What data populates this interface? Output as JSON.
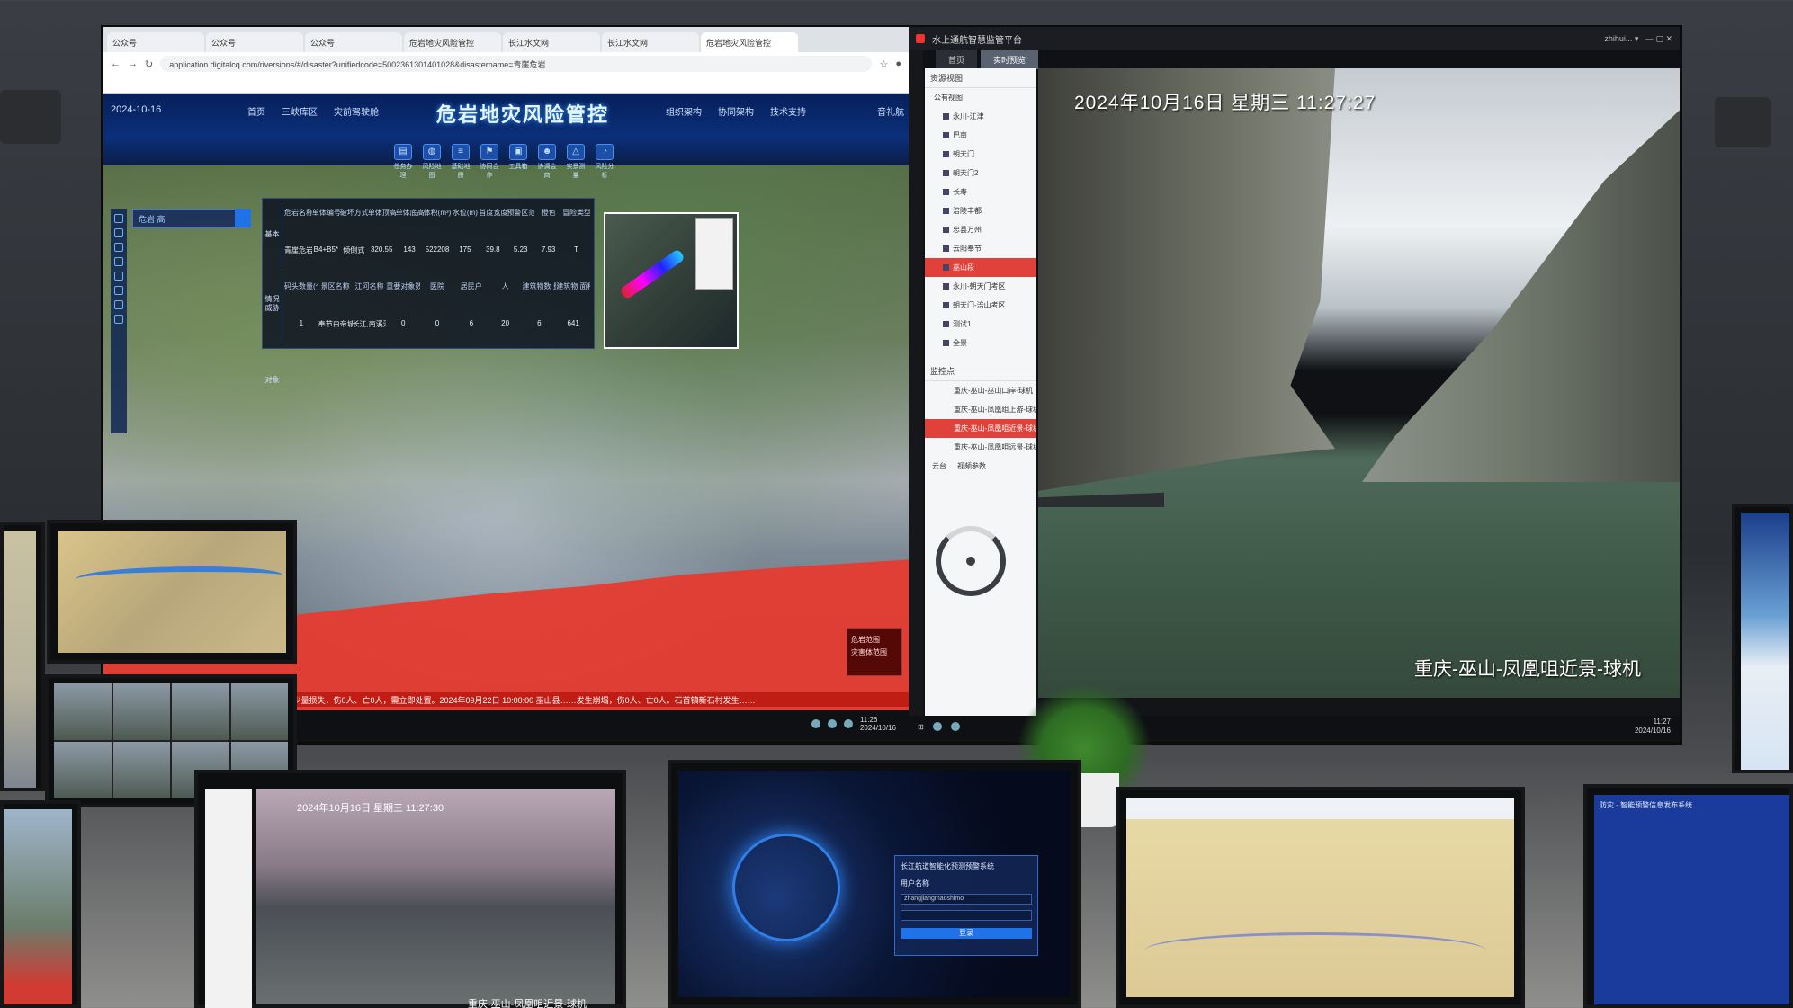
{
  "browser": {
    "tabs": [
      "公众号",
      "公众号",
      "公众号",
      "危岩地灾风险管控",
      "长江水文网",
      "长江水文网",
      "危岩地灾风险管控"
    ],
    "url": "application.digitalcq.com/riversions/#/disaster?unifiedcode=5002361301401028&disastername=青崖危岩"
  },
  "app": {
    "date": "2024-10-16",
    "nav_left": [
      "首页",
      "三峡库区",
      "灾前驾驶舱"
    ],
    "title": "危岩地灾风险管控",
    "nav_right": [
      "组织架构",
      "协同架构",
      "技术支持"
    ],
    "user": "音礼航",
    "tools": [
      "任务办理",
      "风险地图",
      "基础地质",
      "协同合作",
      "工具箱",
      "协调会商",
      "实景测量",
      "风险分析"
    ],
    "search_placeholder": "危岩   高",
    "info_table": {
      "section1": "基本情况",
      "headers1": [
        "危岩名称",
        "单体编号",
        "破坏方式",
        "单体顶高(m)",
        "单体底高(m)",
        "体积(m³)",
        "水位(m)",
        "首度宽度(m)",
        "预警区范围(km) 红色",
        "橙色",
        "冒险类型"
      ],
      "row1": [
        "青崖危岩",
        "B4+B5*",
        "倾倒式",
        "320.55",
        "143",
        "522208",
        "175",
        "39.8",
        "5.23",
        "7.93",
        "T"
      ],
      "section2": "威胁对象",
      "headers2": [
        "码头数量(个)",
        "景区名称",
        "江河名称",
        "重要对象数量 学校",
        "医院",
        "居民户",
        "人",
        "建筑物数 量(个)",
        "建筑物 面积(m²)"
      ],
      "row2": [
        "1",
        "奉节白帝城-瞿塘峡景区",
        "长江,南溪河,草堂河",
        "0",
        "0",
        "6",
        "20",
        "6",
        "641"
      ]
    },
    "legend": [
      "危岩范围",
      "灾害体范围"
    ],
    "ticker": "00 重庆市沙坪坝区歌乐山街道歌乐村发生崩塌，造成少量损失，伤0人、亡0人，需立即处置。2024年09月22日 10:00:00 巫山县……发生崩塌，伤0人、亡0人。石首镇新石村发生……",
    "taskbar_time": "11:26",
    "taskbar_date": "2024/10/16"
  },
  "monitor": {
    "window_title": "水上通航智慧监管平台",
    "user": "zhihui...",
    "tabs": [
      "首页",
      "实时预览"
    ],
    "tree_header": "资源视图",
    "root": "公有视图",
    "tree_items": [
      "永川-江津",
      "巴南",
      "朝天门",
      "朝天门2",
      "长寿",
      "涪陵丰都",
      "忠县万州",
      "云阳奉节",
      "巫山段",
      "永川-朝天门考区",
      "朝天门-涪山考区",
      "测试1",
      "全景"
    ],
    "selected_item": "巫山段",
    "monitor_points_header": "监控点",
    "points": [
      "重庆-巫山-巫山口岸-球机",
      "重庆-巫山-凤凰组上游-球机",
      "重庆-巫山-凤凰咀近景-球机",
      "重庆-巫山-凤凰咀远景-球机"
    ],
    "selected_point": "重庆-巫山-凤凰咀近景-球机",
    "ptz_tabs": [
      "云台",
      "视频参数"
    ],
    "osd_time": "2024年10月16日  星期三  11:27:27",
    "osd_camera": "重庆-巫山-凤凰咀近景-球机",
    "taskbar_time": "11:27",
    "taskbar_date": "2024/10/16"
  },
  "desk": {
    "video_time": "2024年10月16日 星期三 11:27:30",
    "video_camera": "重庆-巫山-凤凰咀近景-球机",
    "login_title": "长江航道智能化预测预警系统",
    "login_user_label": "用户名称",
    "login_user_value": "zhangjiangmaoshimo",
    "login_button": "登录",
    "blue_title": "防灾 - 智能预警信息发布系统"
  }
}
